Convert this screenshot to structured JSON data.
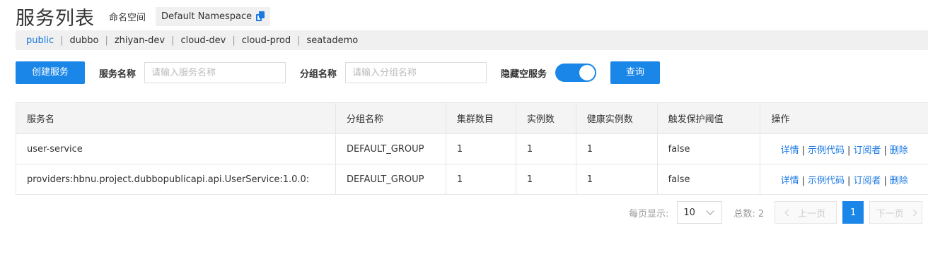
{
  "header": {
    "title": "服务列表",
    "namespace_label": "命名空间",
    "namespace_value": "Default Namespace"
  },
  "namespaces": [
    "public",
    "dubbo",
    "zhiyan-dev",
    "cloud-dev",
    "cloud-prod",
    "seatademo"
  ],
  "namespace_separator": "|",
  "filters": {
    "create_label": "创建服务",
    "service_name_label": "服务名称",
    "service_name_placeholder": "请输入服务名称",
    "group_name_label": "分组名称",
    "group_name_placeholder": "请输入分组名称",
    "hide_empty_label": "隐藏空服务",
    "hide_empty_on": true,
    "query_label": "查询"
  },
  "table": {
    "columns": [
      "服务名",
      "分组名称",
      "集群数目",
      "实例数",
      "健康实例数",
      "触发保护阈值",
      "操作"
    ],
    "rows": [
      {
        "service": "user-service",
        "group": "DEFAULT_GROUP",
        "clusters": "1",
        "instances": "1",
        "healthy": "1",
        "threshold": "false"
      },
      {
        "service": "providers:hbnu.project.dubbopublicapi.api.UserService:1.0.0:",
        "group": "DEFAULT_GROUP",
        "clusters": "1",
        "instances": "1",
        "healthy": "1",
        "threshold": "false"
      }
    ],
    "actions": {
      "detail": "详情",
      "sample_code": "示例代码",
      "subscribers": "订阅者",
      "delete": "删除",
      "sep": "|"
    }
  },
  "pagination": {
    "per_page_label": "每页显示:",
    "per_page_value": "10",
    "total_label": "总数: 2",
    "prev_label": "上一页",
    "current_page": "1",
    "next_label": "下一页"
  },
  "colors": {
    "accent": "#1a86e8",
    "link": "#1a78e2"
  }
}
